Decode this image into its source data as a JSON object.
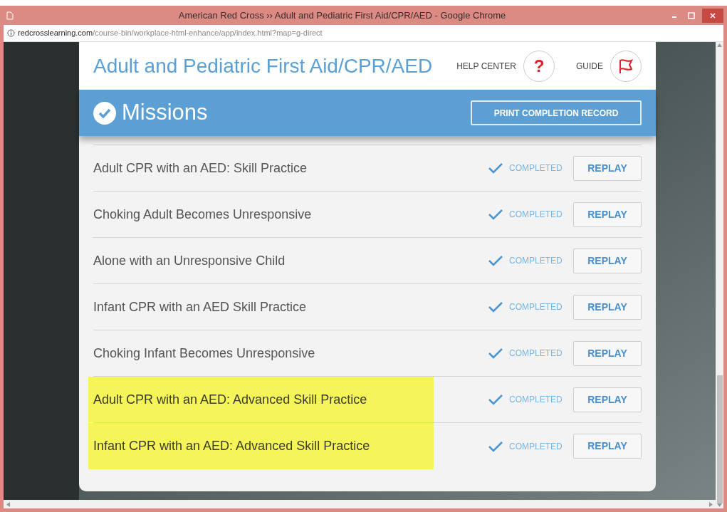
{
  "window": {
    "title": "American Red Cross ›› Adult and Pediatric First Aid/CPR/AED - Google Chrome"
  },
  "address_bar": {
    "domain": "redcrosslearning.com",
    "path": "/course-bin/workplace-html-enhance/app/index.html?map=g-direct"
  },
  "header": {
    "title": "Adult and Pediatric First Aid/CPR/AED",
    "help_label": "HELP CENTER",
    "help_button": "?",
    "guide_label": "GUIDE"
  },
  "banner": {
    "title": "Missions",
    "print_button": "PRINT COMPLETION RECORD"
  },
  "missions": [
    {
      "title": "Adult CPR with an AED: Skill Practice",
      "status": "COMPLETED",
      "button": "REPLAY",
      "highlighted": false
    },
    {
      "title": "Choking Adult Becomes Unresponsive",
      "status": "COMPLETED",
      "button": "REPLAY",
      "highlighted": false
    },
    {
      "title": "Alone with an Unresponsive Child",
      "status": "COMPLETED",
      "button": "REPLAY",
      "highlighted": false
    },
    {
      "title": "Infant CPR with an AED Skill Practice",
      "status": "COMPLETED",
      "button": "REPLAY",
      "highlighted": false
    },
    {
      "title": "Choking Infant Becomes Unresponsive",
      "status": "COMPLETED",
      "button": "REPLAY",
      "highlighted": false
    },
    {
      "title": "Adult CPR with an AED: Advanced Skill Practice",
      "status": "COMPLETED",
      "button": "REPLAY",
      "highlighted": true
    },
    {
      "title": "Infant CPR with an AED: Advanced Skill Practice",
      "status": "COMPLETED",
      "button": "REPLAY",
      "highlighted": true
    }
  ]
}
